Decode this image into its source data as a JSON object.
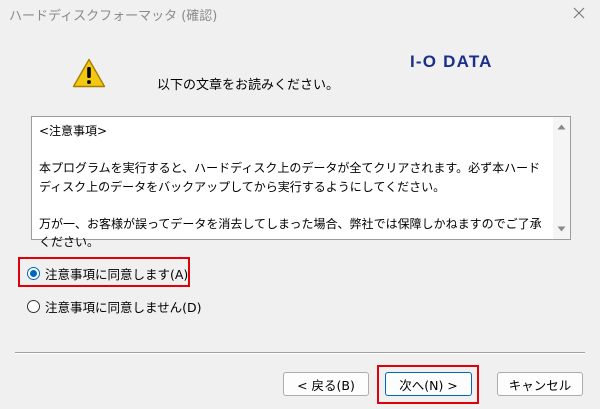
{
  "window": {
    "title": "ハードディスクフォーマッタ (確認)",
    "close_icon": "close-icon"
  },
  "header": {
    "warning_icon": "warning-icon",
    "instruction": "以下の文章をお読みください。",
    "logo_text": "I-O DATA",
    "logo_color": "#1a2f8a"
  },
  "notice": {
    "text": "<注意事項>\n\n本プログラムを実行すると、ハードディスク上のデータが全てクリアされます。必ず本ハードディスク上のデータをバックアップしてから実行するようにしてください。\n\n万が一、お客様が誤ってデータを消去してしまった場合、弊社では保障しかねますのでご了承ください。",
    "scroll_up_icon": "triangle-up-icon",
    "scroll_down_icon": "triangle-down-icon"
  },
  "options": [
    {
      "label": "注意事項に同意します(A)",
      "selected": true
    },
    {
      "label": "注意事項に同意しません(D)",
      "selected": false
    }
  ],
  "buttons": {
    "back": "< 戻る(B)",
    "next": "次へ(N) >",
    "cancel": "キャンセル"
  },
  "colors": {
    "highlight": "#e0000a",
    "accent": "#0067c0"
  }
}
